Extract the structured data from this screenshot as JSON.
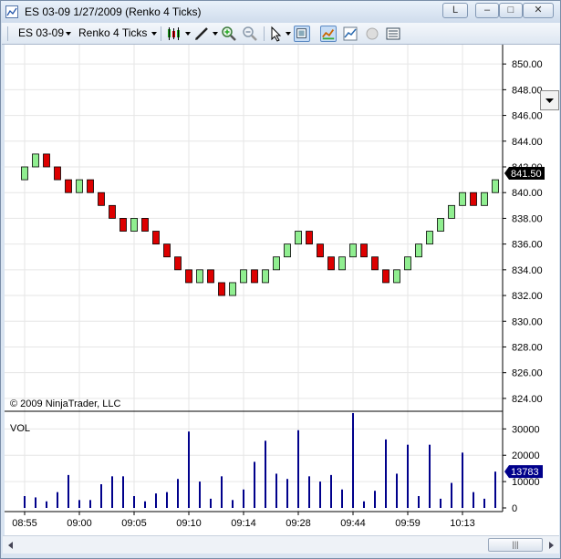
{
  "window": {
    "title": "ES 03-09  1/27/2009 (Renko 4 Ticks)",
    "link_button_label": "L",
    "minimize_glyph": "–",
    "maximize_glyph": "□",
    "close_glyph": "✕"
  },
  "toolbar": {
    "instrument": "ES 03-09",
    "period": "Renko 4 Ticks",
    "icons": [
      "chart-style-icon",
      "drawing-tool-icon",
      "zoom-in-icon",
      "zoom-out-icon",
      "cursor-icon",
      "data-box-icon",
      "indicators-icon",
      "strategies-icon",
      "properties-icon",
      "chart-trader-icon"
    ]
  },
  "colors": {
    "up_brick": "#90ee90",
    "down_brick": "#dd0000",
    "volume_bar": "#00008b",
    "grid": "#e6e6e6",
    "last_price_bg": "#000000",
    "last_volume_bg": "#00008b"
  },
  "copyright": "© 2009 NinjaTrader, LLC",
  "chart_data": [
    {
      "type": "renko",
      "y_tick_labels": [
        "850.00",
        "848.00",
        "846.00",
        "844.00",
        "842.00",
        "840.00",
        "838.00",
        "836.00",
        "834.00",
        "832.00",
        "830.00",
        "828.00",
        "826.00",
        "824.00"
      ],
      "ylim": [
        823,
        851.5
      ],
      "brick_size": 1,
      "bricks": [
        {
          "close": 842,
          "dir": "up"
        },
        {
          "close": 843,
          "dir": "up"
        },
        {
          "close": 842,
          "dir": "down"
        },
        {
          "close": 841,
          "dir": "down"
        },
        {
          "close": 840,
          "dir": "down"
        },
        {
          "close": 841,
          "dir": "up"
        },
        {
          "close": 840,
          "dir": "down"
        },
        {
          "close": 839,
          "dir": "down"
        },
        {
          "close": 838,
          "dir": "down"
        },
        {
          "close": 837,
          "dir": "down"
        },
        {
          "close": 838,
          "dir": "up"
        },
        {
          "close": 837,
          "dir": "down"
        },
        {
          "close": 836,
          "dir": "down"
        },
        {
          "close": 835,
          "dir": "down"
        },
        {
          "close": 834,
          "dir": "down"
        },
        {
          "close": 833,
          "dir": "down"
        },
        {
          "close": 834,
          "dir": "up"
        },
        {
          "close": 833,
          "dir": "down"
        },
        {
          "close": 832,
          "dir": "down"
        },
        {
          "close": 833,
          "dir": "up"
        },
        {
          "close": 834,
          "dir": "up"
        },
        {
          "close": 833,
          "dir": "down"
        },
        {
          "close": 834,
          "dir": "up"
        },
        {
          "close": 835,
          "dir": "up"
        },
        {
          "close": 836,
          "dir": "up"
        },
        {
          "close": 837,
          "dir": "up"
        },
        {
          "close": 836,
          "dir": "down"
        },
        {
          "close": 835,
          "dir": "down"
        },
        {
          "close": 834,
          "dir": "down"
        },
        {
          "close": 835,
          "dir": "up"
        },
        {
          "close": 836,
          "dir": "up"
        },
        {
          "close": 835,
          "dir": "down"
        },
        {
          "close": 834,
          "dir": "down"
        },
        {
          "close": 833,
          "dir": "down"
        },
        {
          "close": 834,
          "dir": "up"
        },
        {
          "close": 835,
          "dir": "up"
        },
        {
          "close": 836,
          "dir": "up"
        },
        {
          "close": 837,
          "dir": "up"
        },
        {
          "close": 838,
          "dir": "up"
        },
        {
          "close": 839,
          "dir": "up"
        },
        {
          "close": 840,
          "dir": "up"
        },
        {
          "close": 839,
          "dir": "down"
        },
        {
          "close": 840,
          "dir": "up"
        },
        {
          "close": 841,
          "dir": "up"
        }
      ],
      "last_price_label": "841.50",
      "last_price": 841.5
    },
    {
      "type": "bar",
      "panel_label": "VOL",
      "y_tick_labels": [
        "30000",
        "20000",
        "10000",
        "0"
      ],
      "ylim": [
        0,
        36000
      ],
      "values": [
        4500,
        4000,
        2500,
        6000,
        12500,
        3000,
        3000,
        9000,
        12000,
        12000,
        4500,
        2500,
        5500,
        6000,
        11000,
        29000,
        10000,
        3500,
        12000,
        3000,
        7000,
        17500,
        25500,
        13000,
        11000,
        29500,
        12000,
        10000,
        12500,
        7000,
        36000,
        2500,
        6500,
        26000,
        13000,
        24000,
        4500,
        24000,
        3500,
        9500,
        21000,
        6000,
        3500,
        13783
      ],
      "last_value_label": "13783",
      "last_value": 13783
    }
  ],
  "x_tick_labels": [
    "08:55",
    "09:00",
    "09:05",
    "09:10",
    "09:14",
    "09:28",
    "09:44",
    "09:59",
    "10:13"
  ]
}
